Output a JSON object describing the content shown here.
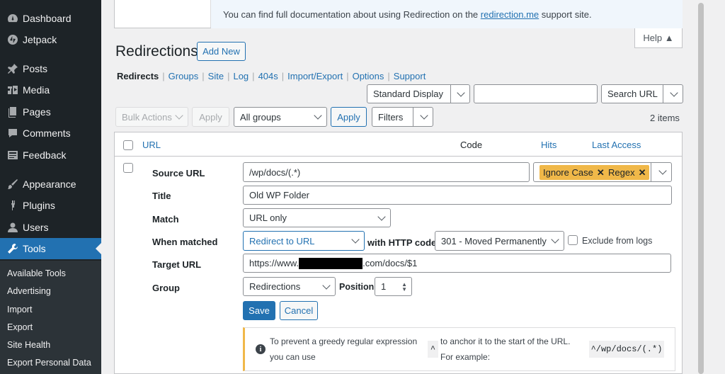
{
  "sidebar": {
    "items": [
      {
        "label": "Dashboard",
        "icon": "dashboard-icon"
      },
      {
        "label": "Jetpack",
        "icon": "jetpack-icon"
      },
      {
        "label": "Posts",
        "icon": "pin-icon"
      },
      {
        "label": "Media",
        "icon": "media-icon"
      },
      {
        "label": "Pages",
        "icon": "pages-icon"
      },
      {
        "label": "Comments",
        "icon": "comment-icon"
      },
      {
        "label": "Feedback",
        "icon": "feedback-icon"
      },
      {
        "label": "Appearance",
        "icon": "brush-icon"
      },
      {
        "label": "Plugins",
        "icon": "plugin-icon"
      },
      {
        "label": "Users",
        "icon": "user-icon"
      },
      {
        "label": "Tools",
        "icon": "wrench-icon"
      }
    ],
    "submenu": [
      "Available Tools",
      "Advertising",
      "Import",
      "Export",
      "Site Health",
      "Export Personal Data"
    ]
  },
  "notice": {
    "prefix": "You can find full documentation about using Redirection on the ",
    "link": "redirection.me",
    "suffix": " support site."
  },
  "help_tab": "Help ▲",
  "page": {
    "title": "Redirections",
    "add_new": "Add New"
  },
  "subnav": [
    "Redirects",
    "Groups",
    "Site",
    "Log",
    "404s",
    "Import/Export",
    "Options",
    "Support"
  ],
  "search": {
    "display_select": "Standard Display",
    "search_value": "",
    "search_button": "Search URL"
  },
  "filters": {
    "bulk_actions": "Bulk Actions",
    "apply_disabled": "Apply",
    "groups_select": "All groups",
    "apply": "Apply",
    "filters": "Filters",
    "count": "2 items"
  },
  "table": {
    "headers": {
      "url": "URL",
      "code": "Code",
      "hits": "Hits",
      "last_access": "Last Access"
    }
  },
  "form": {
    "source_url_label": "Source URL",
    "source_url": "/wp/docs/(.*)",
    "tags": [
      "Ignore Case",
      "Regex"
    ],
    "title_label": "Title",
    "title": "Old WP Folder",
    "match_label": "Match",
    "match": "URL only",
    "when_matched_label": "When matched",
    "when_matched": "Redirect to URL",
    "with_http_code": "with HTTP code",
    "http_code": "301 - Moved Permanently",
    "exclude_logs": "Exclude from logs",
    "target_url_label": "Target URL",
    "target_url_prefix": "https://www.",
    "target_url_suffix": ".com/docs/$1",
    "group_label": "Group",
    "group": "Redirections",
    "position_label": "Position",
    "position": "1",
    "save": "Save",
    "cancel": "Cancel"
  },
  "info": {
    "text1a": "To prevent a greedy regular expression",
    "text1b": "you can use",
    "caret": "^",
    "text2a": "to anchor it to the start of the URL.",
    "text2b": "For example:",
    "example": "^/wp/docs/(.*)"
  }
}
